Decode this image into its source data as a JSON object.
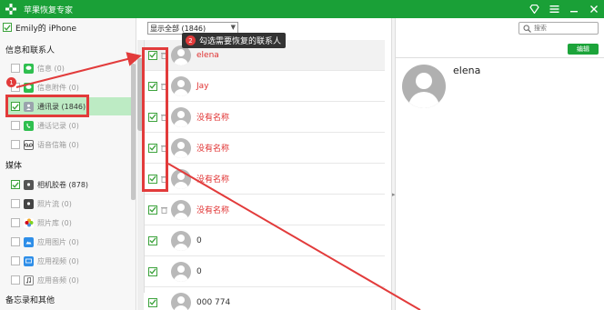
{
  "app": {
    "title": "苹果恢复专家",
    "colors": {
      "brand": "#1aa037",
      "accent_red": "#e23b3b",
      "selected_row": "#bdebc4",
      "edit_button": "#1ca43a"
    },
    "window_controls": [
      "diamond-icon",
      "settings-icon",
      "minimize-icon",
      "close-icon"
    ]
  },
  "sidebar": {
    "device": {
      "name": "Emily的 iPhone",
      "checked": true
    },
    "sections": [
      {
        "title": "信息和联系人",
        "items": [
          {
            "label": "信息 (0)",
            "icon": "message-icon",
            "checked": false
          },
          {
            "label": "信息附件 (0)",
            "icon": "attachment-icon",
            "checked": false
          },
          {
            "label": "通讯录 (1846)",
            "icon": "contacts-icon",
            "checked": true,
            "selected": true
          },
          {
            "label": "通话记录 (0)",
            "icon": "phone-icon",
            "checked": false
          },
          {
            "label": "语音信箱 (0)",
            "icon": "voicemail-icon",
            "checked": false
          }
        ]
      },
      {
        "title": "媒体",
        "items": [
          {
            "label": "相机胶卷 (878)",
            "icon": "camera-icon",
            "checked": true
          },
          {
            "label": "照片流 (0)",
            "icon": "photostream-icon",
            "checked": false
          },
          {
            "label": "照片库 (0)",
            "icon": "photos-icon",
            "checked": false
          },
          {
            "label": "应用图片 (0)",
            "icon": "app-photo-icon",
            "checked": false
          },
          {
            "label": "应用视频 (0)",
            "icon": "app-video-icon",
            "checked": false
          },
          {
            "label": "应用音频 (0)",
            "icon": "app-audio-icon",
            "checked": false
          }
        ]
      },
      {
        "title": "备忘录和其他",
        "items": []
      }
    ]
  },
  "list": {
    "filter": "显示全部 (1846)",
    "contacts": [
      {
        "name": "elena",
        "red": true,
        "selected": true
      },
      {
        "name": "Jay",
        "red": true
      },
      {
        "name": "没有名称",
        "red": true
      },
      {
        "name": "没有名称",
        "red": true
      },
      {
        "name": "没有名称",
        "red": true
      },
      {
        "name": "没有名称",
        "red": true
      },
      {
        "name": "0",
        "red": false
      },
      {
        "name": "0",
        "red": false
      },
      {
        "name": "000 774",
        "red": false
      }
    ]
  },
  "detail": {
    "search_placeholder": "搜索",
    "edit_label": "编辑",
    "contact_name": "elena"
  },
  "annotations": {
    "step1": "1",
    "step2": "2",
    "callout_text": "勾选需要恢复的联系人"
  }
}
